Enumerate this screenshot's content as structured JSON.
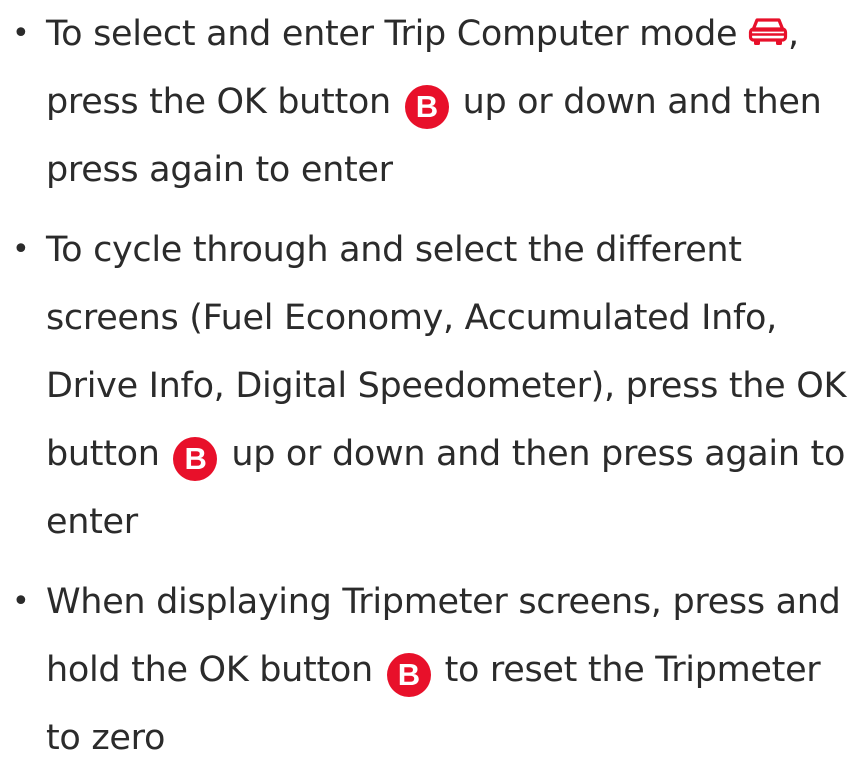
{
  "items": [
    {
      "before_icon": "To select and enter Trip Computer mode",
      "icon": "car-icon",
      "between": ", press the OK button",
      "badge": "B",
      "after": "up or down and then press again to enter"
    },
    {
      "before": "To cycle through and select the different screens (Fuel Economy, Accumulated Info, Drive Info, Digital Speedometer), press the OK button",
      "badge": "B",
      "after": "up or down and then press again to enter"
    },
    {
      "before": "When displaying Tripmeter screens, press and hold the OK button",
      "badge": "B",
      "after": "to reset the Tripmeter to zero"
    }
  ],
  "colors": {
    "accent": "#e8102a",
    "text": "#2b2b2b"
  }
}
